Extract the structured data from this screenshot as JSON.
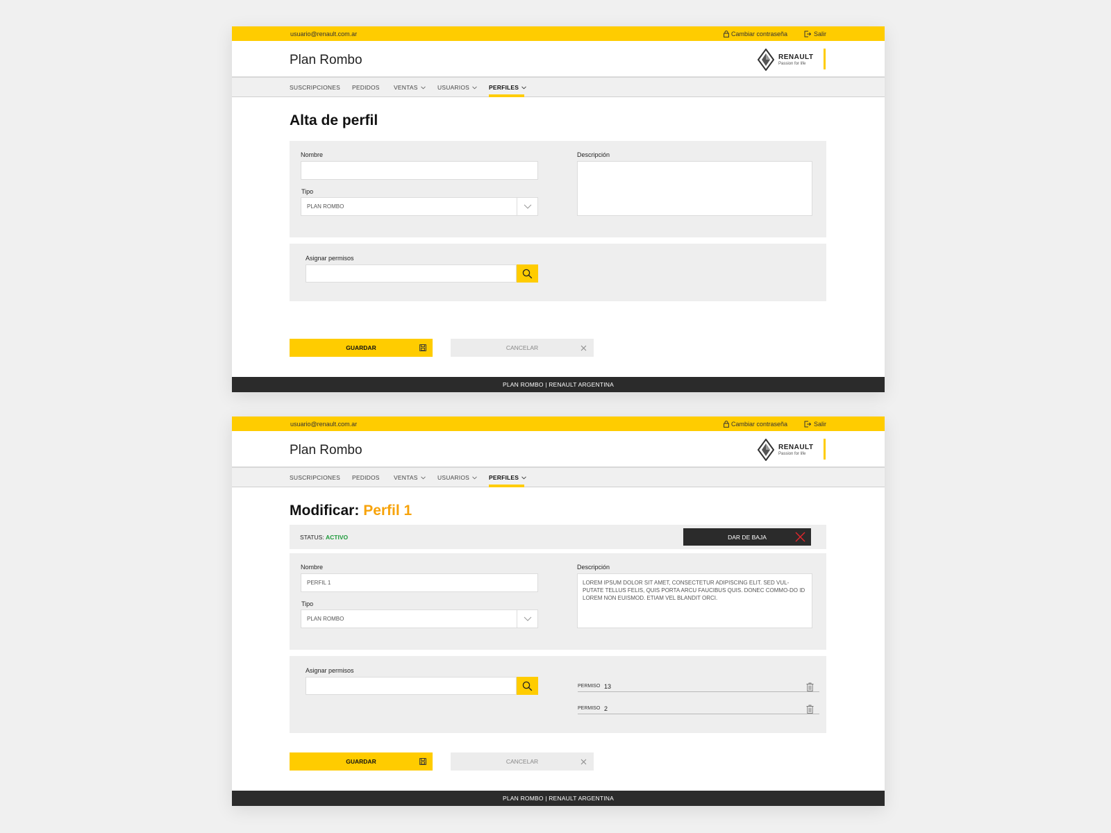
{
  "user": {
    "email": "usuario@renault.com.ar",
    "change_password": "Cambiar contraseña",
    "logout": "Salir"
  },
  "app_title": "Plan Rombo",
  "brand": {
    "name": "RENAULT",
    "slogan": "Passion for life"
  },
  "nav": [
    {
      "label": "SUSCRIPCIONES",
      "dropdown": false
    },
    {
      "label": "PEDIDOS",
      "dropdown": false
    },
    {
      "label": "VENTAS",
      "dropdown": true
    },
    {
      "label": "USUARIOS",
      "dropdown": true
    },
    {
      "label": "PERFILES",
      "dropdown": true,
      "active": true
    }
  ],
  "screen1": {
    "title": "Alta de perfil",
    "nombre_label": "Nombre",
    "nombre_value": "",
    "tipo_label": "Tipo",
    "tipo_value": "PLAN ROMBO",
    "descripcion_label": "Descripción",
    "descripcion_value": "",
    "permisos_label": "Asignar permisos",
    "permisos_value": "",
    "save_label": "GUARDAR",
    "cancel_label": "CANCELAR"
  },
  "screen2": {
    "title_prefix": "Modificar:",
    "title_name": "Perfil 1",
    "status_label": "STATUS:",
    "status_value": "ACTIVO",
    "baja_label": "DAR DE BAJA",
    "nombre_label": "Nombre",
    "nombre_value": "PERFIL 1",
    "tipo_label": "Tipo",
    "tipo_value": "PLAN ROMBO",
    "descripcion_label": "Descripción",
    "descripcion_value": "LOREM IPSUM DOLOR SIT AMET, CONSECTETUR ADIPISCING ELIT. SED VUL-PUTATE TELLUS FELIS, QUIS PORTA ARCU FAUCIBUS QUIS. DONEC COMMO-DO ID LOREM NON EUISMOD. ETIAM VEL BLANDIT ORCI.",
    "permisos_label": "Asignar permisos",
    "permisos_value": "",
    "permissions": [
      {
        "label": "PERMISO",
        "number": "13"
      },
      {
        "label": "PERMISO",
        "number": "2"
      }
    ],
    "save_label": "GUARDAR",
    "cancel_label": "CANCELAR"
  },
  "footer": "PLAN ROMBO | RENAULT ARGENTINA",
  "colors": {
    "accent": "#ffcc00",
    "title_accent": "#f7a30b",
    "status_active": "#1d9a3a",
    "footer_bg": "#2b2b2b",
    "danger": "#e5262c"
  }
}
